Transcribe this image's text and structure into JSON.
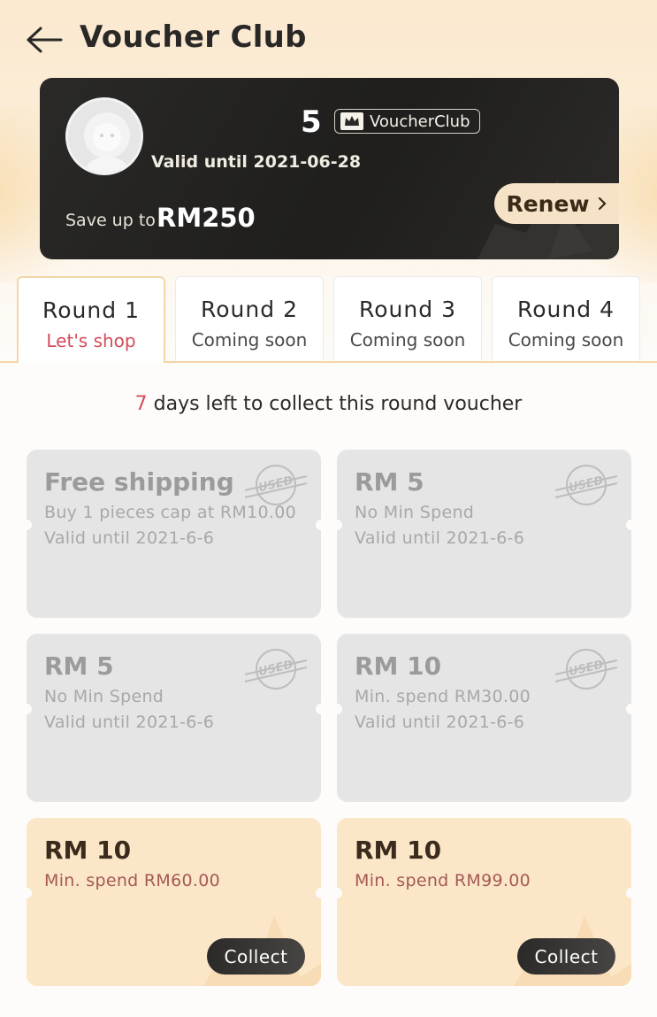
{
  "header": {
    "title": "Voucher Club"
  },
  "card": {
    "member_number": "5",
    "badge_label": "VoucherClub",
    "valid_until": "Valid until 2021-06-28",
    "save_label": "Save up to",
    "save_amount": "RM250",
    "renew_label": "Renew"
  },
  "tabs": [
    {
      "title": "Round 1",
      "status": "Let's shop",
      "active": true
    },
    {
      "title": "Round 2",
      "status": "Coming soon",
      "active": false
    },
    {
      "title": "Round 3",
      "status": "Coming soon",
      "active": false
    },
    {
      "title": "Round 4",
      "status": "Coming soon",
      "active": false
    }
  ],
  "countdown": {
    "days": "7",
    "text": "days left to collect this round voucher"
  },
  "vouchers": [
    {
      "title": "Free shipping",
      "line1": "Buy 1 pieces cap at RM10.00",
      "line2": "Valid until 2021-6-6",
      "state": "used",
      "stamp": "USED"
    },
    {
      "title": "RM 5",
      "line1": "No Min Spend",
      "line2": "Valid until 2021-6-6",
      "state": "used",
      "stamp": "USED"
    },
    {
      "title": "RM 5",
      "line1": "No Min Spend",
      "line2": "Valid until 2021-6-6",
      "state": "used",
      "stamp": "USED"
    },
    {
      "title": "RM 10",
      "line1": "Min. spend RM30.00",
      "line2": "Valid until 2021-6-6",
      "state": "used",
      "stamp": "USED"
    },
    {
      "title": "RM 10",
      "line1": "Min. spend RM60.00",
      "state": "available",
      "action": "Collect"
    },
    {
      "title": "RM 10",
      "line1": "Min. spend RM99.00",
      "state": "available",
      "action": "Collect"
    }
  ],
  "colors": {
    "accent_red": "#d24d5a",
    "gold": "#f1d6a6",
    "card_dark": "#1f1e1c",
    "voucher_used_bg": "#e5e5e5",
    "voucher_available_bg": "#fbe6c7"
  }
}
